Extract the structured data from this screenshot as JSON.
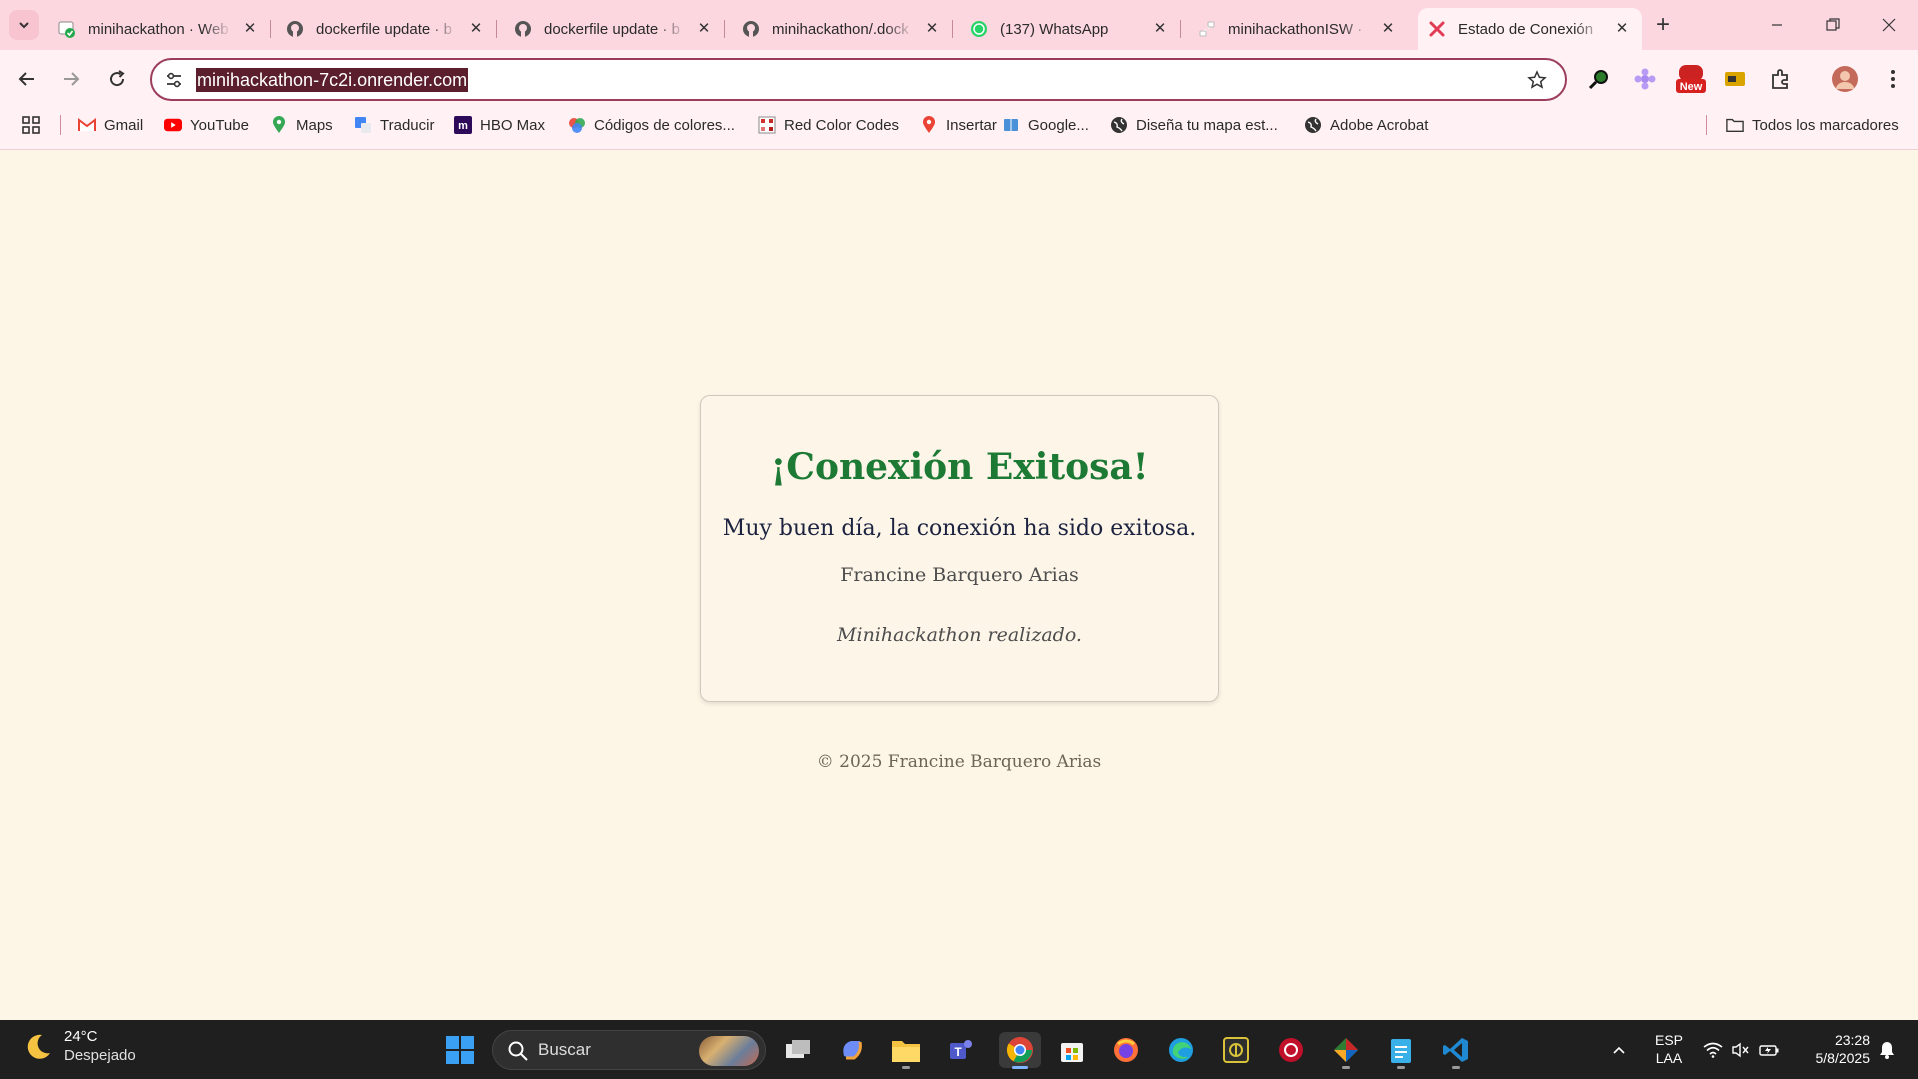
{
  "browser": {
    "tabs": [
      {
        "title": "minihackathon · Web",
        "icon": "render-app-icon"
      },
      {
        "title": "dockerfile update · b",
        "icon": "github-icon"
      },
      {
        "title": "dockerfile update · b",
        "icon": "github-icon"
      },
      {
        "title": "minihackathon/.dock",
        "icon": "github-icon"
      },
      {
        "title": "(137) WhatsApp",
        "icon": "whatsapp-icon"
      },
      {
        "title": "minihackathonISW ·",
        "icon": "render-icon"
      },
      {
        "title": "Estado de Conexión",
        "icon": "red-x-icon",
        "active": true
      }
    ],
    "url": "minihackathon-7c2i.onrender.com",
    "extension_badge": "New",
    "bookmarks": [
      {
        "label": "Gmail",
        "icon": "gmail-icon"
      },
      {
        "label": "YouTube",
        "icon": "youtube-icon"
      },
      {
        "label": "Maps",
        "icon": "maps-icon"
      },
      {
        "label": "Traducir",
        "icon": "translate-icon"
      },
      {
        "label": "HBO Max",
        "icon": "hbo-max-icon"
      },
      {
        "label": "Códigos de colores...",
        "icon": "color-wheel-icon"
      },
      {
        "label": "Red Color Codes",
        "icon": "color-grid-icon"
      },
      {
        "label": "Insertar",
        "icon": "map-pin-icon"
      },
      {
        "label": "Google...",
        "icon": "map-book-icon"
      },
      {
        "label": "Diseña tu mapa est...",
        "icon": "globe-icon"
      },
      {
        "label": "Adobe Acrobat",
        "icon": "globe-icon"
      }
    ],
    "all_bookmarks": "Todos los marcadores"
  },
  "page": {
    "heading": "¡Conexión Exitosa!",
    "message": "Muy buen día, la conexión ha sido exitosa.",
    "author": "Francine Barquero Arias",
    "note": "Minihackathon realizado.",
    "footer": "© 2025 Francine Barquero Arias"
  },
  "taskbar": {
    "weather_temp": "24°C",
    "weather_desc": "Despejado",
    "search_label": "Buscar",
    "lang_top": "ESP",
    "lang_bottom": "LAA",
    "time": "23:28",
    "date": "5/8/2025"
  },
  "colors": {
    "tabstrip": "#fcd7e0",
    "toolbar": "#fff1f4",
    "page_bg": "#fdf6e6",
    "heading": "#1d7a35",
    "taskbar": "#1f1f1f"
  }
}
